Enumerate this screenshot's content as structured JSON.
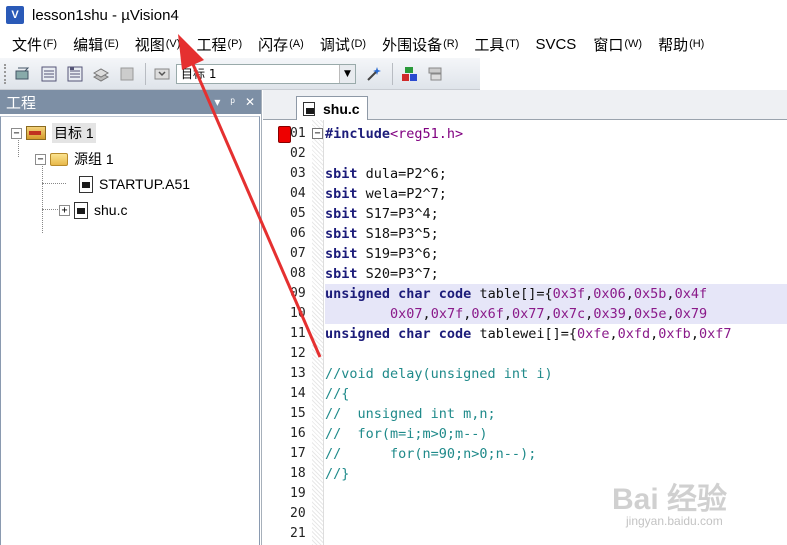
{
  "window": {
    "title": "lesson1shu - µVision4",
    "app_icon": "V"
  },
  "menu": [
    {
      "label": "文件",
      "accel": "(F)"
    },
    {
      "label": "编辑",
      "accel": "(E)"
    },
    {
      "label": "视图",
      "accel": "(V)"
    },
    {
      "label": "工程",
      "accel": "(P)"
    },
    {
      "label": "闪存",
      "accel": "(A)"
    },
    {
      "label": "调试",
      "accel": "(D)"
    },
    {
      "label": "外围设备",
      "accel": "(R)"
    },
    {
      "label": "工具",
      "accel": "(T)"
    },
    {
      "label": "SVCS",
      "accel": ""
    },
    {
      "label": "窗口",
      "accel": "(W)"
    },
    {
      "label": "帮助",
      "accel": "(H)"
    }
  ],
  "toolbar": {
    "icons": [
      "translate-icon",
      "build-icon",
      "rebuild-icon",
      "batch-build-icon",
      "stop-build-icon",
      "download-icon"
    ],
    "target_select": "目标 1",
    "extra_icons": [
      "options-wand-icon",
      "components-icon",
      "books-icon"
    ]
  },
  "project_panel": {
    "title": "工程",
    "header_buttons": [
      "▾",
      "ᵖ",
      "✕"
    ],
    "tree": {
      "target": "目标 1",
      "group": "源组 1",
      "files": [
        "STARTUP.A51",
        "shu.c"
      ]
    }
  },
  "editor": {
    "tab_label": "shu.c",
    "line_numbers": [
      "01",
      "02",
      "03",
      "04",
      "05",
      "06",
      "07",
      "08",
      "09",
      "10",
      "11",
      "12",
      "13",
      "14",
      "15",
      "16",
      "17",
      "18",
      "19",
      "20",
      "21"
    ],
    "lines": [
      [
        {
          "t": "#include",
          "c": "kw"
        },
        {
          "t": "<reg51.h>",
          "c": "str"
        }
      ],
      [],
      [
        {
          "t": "sbit ",
          "c": "kw"
        },
        {
          "t": "dula=P2",
          "c": "pl"
        },
        {
          "t": "^6;",
          "c": "pl"
        }
      ],
      [
        {
          "t": "sbit ",
          "c": "kw"
        },
        {
          "t": "wela=P2",
          "c": "pl"
        },
        {
          "t": "^7;",
          "c": "pl"
        }
      ],
      [
        {
          "t": "sbit ",
          "c": "kw"
        },
        {
          "t": "S17=P3",
          "c": "pl"
        },
        {
          "t": "^4;",
          "c": "pl"
        }
      ],
      [
        {
          "t": "sbit ",
          "c": "kw"
        },
        {
          "t": "S18=P3",
          "c": "pl"
        },
        {
          "t": "^5;",
          "c": "pl"
        }
      ],
      [
        {
          "t": "sbit ",
          "c": "kw"
        },
        {
          "t": "S19=P3",
          "c": "pl"
        },
        {
          "t": "^6;",
          "c": "pl"
        }
      ],
      [
        {
          "t": "sbit ",
          "c": "kw"
        },
        {
          "t": "S20=P3",
          "c": "pl"
        },
        {
          "t": "^7;",
          "c": "pl"
        }
      ],
      [
        {
          "t": "unsigned ",
          "c": "kw"
        },
        {
          "t": "char ",
          "c": "kw"
        },
        {
          "t": "code ",
          "c": "kw"
        },
        {
          "t": "table[]={",
          "c": "pl"
        },
        {
          "t": "0x3f",
          "c": "num"
        },
        {
          "t": ",",
          "c": "pl"
        },
        {
          "t": "0x06",
          "c": "num"
        },
        {
          "t": ",",
          "c": "pl"
        },
        {
          "t": "0x5b",
          "c": "num"
        },
        {
          "t": ",",
          "c": "pl"
        },
        {
          "t": "0x4f",
          "c": "num"
        }
      ],
      [
        {
          "t": "        ",
          "c": "pl"
        },
        {
          "t": "0x07",
          "c": "num"
        },
        {
          "t": ",",
          "c": "pl"
        },
        {
          "t": "0x7f",
          "c": "num"
        },
        {
          "t": ",",
          "c": "pl"
        },
        {
          "t": "0x6f",
          "c": "num"
        },
        {
          "t": ",",
          "c": "pl"
        },
        {
          "t": "0x77",
          "c": "num"
        },
        {
          "t": ",",
          "c": "pl"
        },
        {
          "t": "0x7c",
          "c": "num"
        },
        {
          "t": ",",
          "c": "pl"
        },
        {
          "t": "0x39",
          "c": "num"
        },
        {
          "t": ",",
          "c": "pl"
        },
        {
          "t": "0x5e",
          "c": "num"
        },
        {
          "t": ",",
          "c": "pl"
        },
        {
          "t": "0x79",
          "c": "num"
        }
      ],
      [
        {
          "t": "unsigned ",
          "c": "kw"
        },
        {
          "t": "char ",
          "c": "kw"
        },
        {
          "t": "code ",
          "c": "kw"
        },
        {
          "t": "tablewei[]={",
          "c": "pl"
        },
        {
          "t": "0xfe",
          "c": "num"
        },
        {
          "t": ",",
          "c": "pl"
        },
        {
          "t": "0xfd",
          "c": "num"
        },
        {
          "t": ",",
          "c": "pl"
        },
        {
          "t": "0xfb",
          "c": "num"
        },
        {
          "t": ",",
          "c": "pl"
        },
        {
          "t": "0xf7",
          "c": "num"
        }
      ],
      [],
      [
        {
          "t": "//void delay(unsigned int i)",
          "c": "cmt"
        }
      ],
      [
        {
          "t": "//{",
          "c": "cmt"
        }
      ],
      [
        {
          "t": "//  unsigned int m,n;",
          "c": "cmt"
        }
      ],
      [
        {
          "t": "//  for(m=i;m>0;m--)",
          "c": "cmt"
        }
      ],
      [
        {
          "t": "//      for(n=90;n>0;n--);",
          "c": "cmt"
        }
      ],
      [
        {
          "t": "//}",
          "c": "cmt"
        }
      ],
      [],
      [],
      []
    ],
    "highlighted_lines": [
      9,
      10
    ]
  },
  "watermark": {
    "main": "Bai 经验",
    "sub": "jingyan.baidu.com"
  },
  "colors": {
    "arrow": "#e53030",
    "panel_header": "#7d8fa5",
    "keyword": "#1c1c7a",
    "comment": "#1f8a8a",
    "number": "#8a1a8a"
  }
}
